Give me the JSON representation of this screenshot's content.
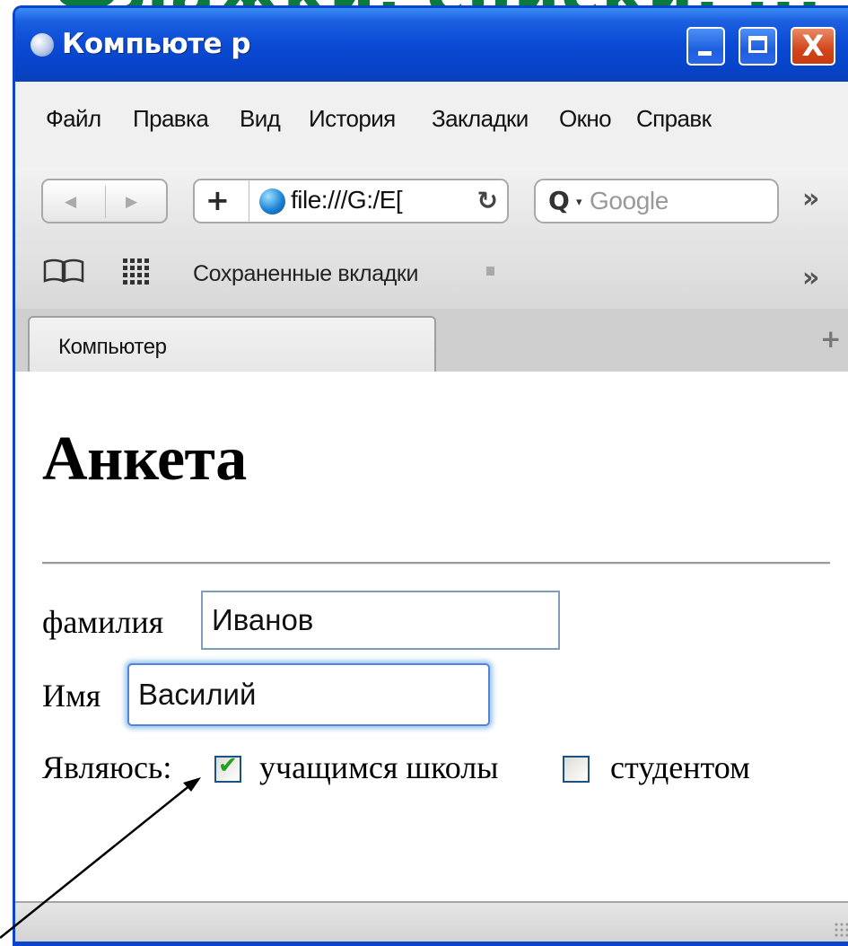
{
  "slide": {
    "title": "Флажки, списки, ...",
    "title_color": "#0b7a3e"
  },
  "window": {
    "title": "Компьютер",
    "title_display": "Компьюте р",
    "controls": {
      "minimize": "minimize",
      "maximize": "maximize",
      "close": "X"
    }
  },
  "menu": [
    "Файл",
    "Правка",
    "Вид",
    "История",
    "Закладки",
    "Окно",
    "Справк"
  ],
  "toolbar": {
    "back_icon": "◀",
    "forward_icon": "▶",
    "add_icon": "+",
    "url": "file:///G:/E[",
    "reload_icon": "↻",
    "search_icon": "Q",
    "search_caret": "▾",
    "search_placeholder": "Google",
    "overflow_icon": "»"
  },
  "bookmarks": {
    "saved_tabs": "Сохраненные вкладки",
    "overflow_icon": "»"
  },
  "tabs": {
    "active_label": "Компьютер",
    "new_tab_icon": "+"
  },
  "page": {
    "heading": "Анкета",
    "form": {
      "surname_label": "фамилия",
      "surname_value": "Иванов",
      "name_label": "Имя",
      "name_value": "Василий",
      "status_label": "Являюсь:",
      "school_checked": true,
      "school_label": "учащимся школы",
      "student_checked": false,
      "student_label": "студентом"
    }
  },
  "colors": {
    "titlebar": "#0a4ad4",
    "close_button": "#d2441c",
    "focus_ring": "#4f86d6",
    "checkbox_tick": "#21a121"
  }
}
